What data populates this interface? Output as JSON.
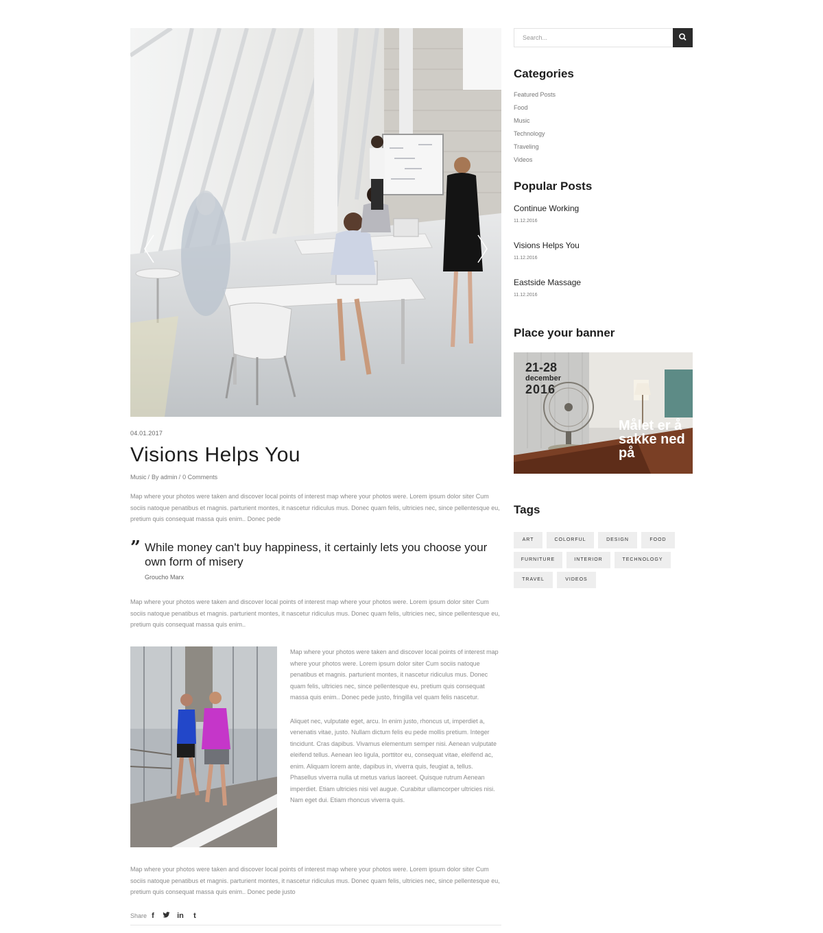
{
  "post": {
    "date": "04.01.2017",
    "title": "Visions Helps You",
    "category": "Music",
    "author": "By admin",
    "comments": "0 Comments",
    "paragraph1": "Map where your photos were taken and discover local points of interest map where your photos were. Lorem ipsum dolor siter Cum sociis natoque penatibus et magnis. parturient montes, it nascetur ridiculus mus. Donec quam felis, ultricies nec, since pellentesque eu, pretium quis consequat massa quis enim.. Donec pede",
    "quote": "While money can't buy happiness, it certainly lets you choose your own form of misery",
    "quote_author": "Groucho Marx",
    "paragraph2": "Map where your photos were taken and discover local points of interest map where your photos were. Lorem ipsum dolor siter Cum sociis natoque penatibus et magnis. parturient montes, it nascetur ridiculus mus. Donec quam felis, ultricies nec, since pellentesque eu, pretium quis consequat massa quis enim..",
    "side_paragraph1": "Map where your photos were taken and discover local points of interest map where your photos were. Lorem ipsum dolor siter Cum sociis natoque penatibus et magnis. parturient montes, it nascetur ridiculus mus. Donec quam felis, ultricies nec, since pellentesque eu, pretium quis consequat  massa quis enim.. Donec pede justo, fringilla vel quam felis nascetur.",
    "side_paragraph2": "Aliquet nec, vulputate eget, arcu. In enim justo, rhoncus ut, imperdiet a, venenatis vitae, justo. Nullam dictum felis eu pede mollis pretium. Integer tincidunt. Cras dapibus. Vivamus elementum semper nisi. Aenean vulputate eleifend tellus. Aenean leo ligula, porttitor eu, consequat vitae, eleifend ac, enim. Aliquam lorem ante, dapibus in, viverra quis, feugiat a, tellus. Phasellus viverra nulla ut metus varius laoreet. Quisque rutrum Aenean imperdiet. Etiam ultricies nisi vel augue. Curabitur ullamcorper ultricies nisi. Nam eget dui. Etiam rhoncus viverra quis.",
    "paragraph4": "Map where your photos were taken and discover local points of interest map where your photos were. Lorem ipsum dolor siter Cum sociis natoque penatibus et magnis. parturient montes, it nascetur ridiculus mus. Donec quam felis, ultricies nec, since pellentesque eu, pretium quis consequat massa quis enim.. Donec pede justo",
    "share_label": "Share",
    "share_icons": [
      "facebook-icon",
      "twitter-icon",
      "linkedin-icon",
      "tumblr-icon"
    ]
  },
  "sidebar": {
    "search_placeholder": "Search...",
    "categories_title": "Categories",
    "categories": [
      "Featured Posts",
      "Food",
      "Music",
      "Technology",
      "Traveling",
      "Videos"
    ],
    "popular_title": "Popular Posts",
    "popular": [
      {
        "title": "Continue Working",
        "date": "11.12.2016"
      },
      {
        "title": "Visions Helps You",
        "date": "11.12.2016"
      },
      {
        "title": "Eastside Massage",
        "date": "11.12.2016"
      }
    ],
    "banner_title": "Place your banner",
    "banner": {
      "date_range": "21-28",
      "month": "december",
      "year": "2016",
      "slogan": "Målet er å sakke ned på"
    },
    "tags_title": "Tags",
    "tags": [
      "ART",
      "COLORFUL",
      "DESIGN",
      "FOOD",
      "FURNITURE",
      "INTERIOR",
      "TECHNOLOGY",
      "TRAVEL",
      "VIDEOS"
    ]
  },
  "colors": {
    "search_button": "#2b2b2b",
    "tag_background": "#eeeeee",
    "body_text": "#8a8a8a",
    "heading": "#1e1e1e"
  }
}
